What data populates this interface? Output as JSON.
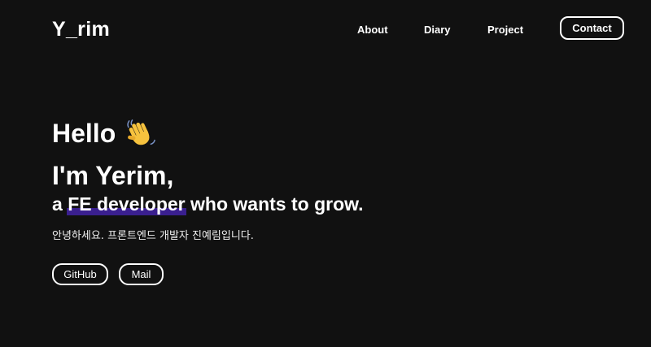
{
  "header": {
    "logo": "Y_rim",
    "nav": {
      "about": "About",
      "diary": "Diary",
      "project": "Project",
      "contact": "Contact"
    }
  },
  "hero": {
    "hello": "Hello",
    "wave_icon": "waving-hand-icon",
    "name_line": "I'm Yerim,",
    "role_prefix": "a",
    "role_highlight": "FE developer",
    "role_suffix": "who wants to grow.",
    "greeting": "안녕하세요. 프론트엔드 개발자 진예림입니다.",
    "buttons": {
      "github": "GitHub",
      "mail": "Mail"
    }
  },
  "colors": {
    "background": "#111111",
    "text": "#ffffff",
    "highlight": "#3a1f8f",
    "wave": "#f6c23e"
  }
}
